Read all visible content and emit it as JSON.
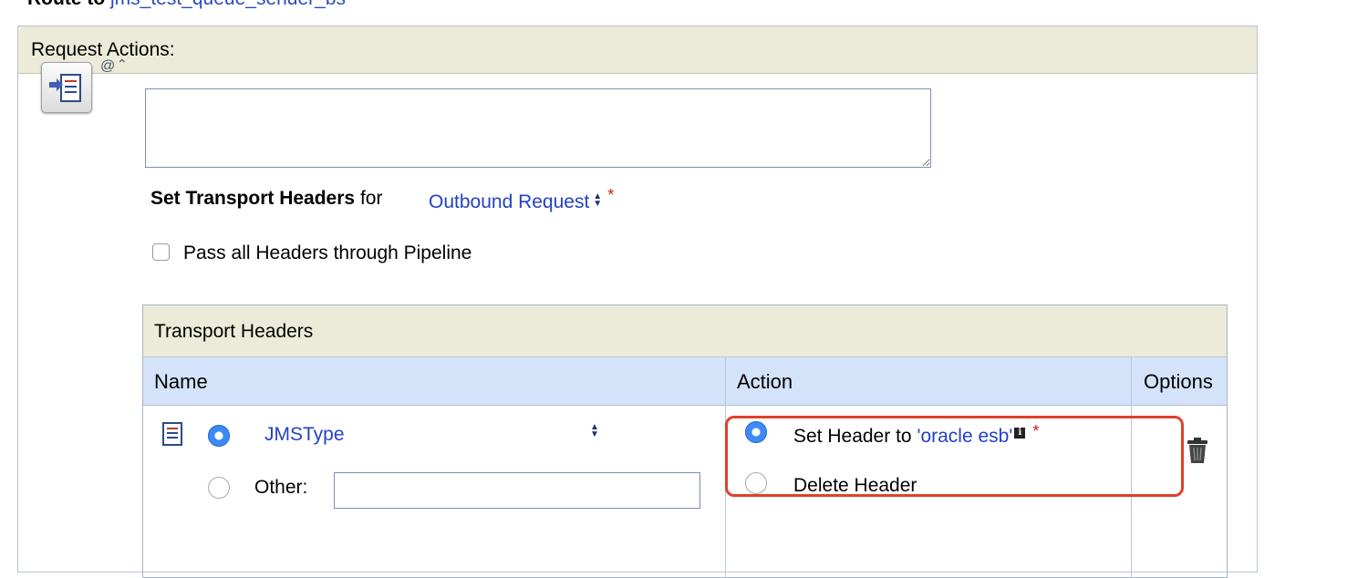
{
  "route": {
    "label": "Route to",
    "service": "jms_test_queue_sender_bs"
  },
  "request_actions": {
    "title": "Request Actions:",
    "comment_value": "",
    "set_transport_headers": {
      "label_bold": "Set Transport Headers",
      "label_for": "for",
      "target_selected": "Outbound Request",
      "required_marker": "*"
    },
    "pass_all_headers": {
      "label": "Pass all Headers through Pipeline",
      "checked": false
    }
  },
  "transport_headers": {
    "caption": "Transport Headers",
    "columns": [
      "Name",
      "Action",
      "Options"
    ],
    "rows": [
      {
        "header_selected": "JMSType",
        "other_label": "Other:",
        "other_value": "",
        "action_set_label": "Set Header to",
        "action_set_expression": "'oracle esb'",
        "action_required_marker": "*",
        "action_delete_label": "Delete Header"
      }
    ]
  },
  "colors": {
    "link": "#2441c4",
    "panel_header_bg": "#ecebd9",
    "column_header_bg": "#d5e3fa",
    "radio_selected": "#3d8af5",
    "required": "#c81e1e",
    "highlight": "#e0402b"
  },
  "icons": {
    "stage": "route-stage-icon",
    "document": "document-icon",
    "info": "info-icon",
    "delete": "trash-icon"
  }
}
